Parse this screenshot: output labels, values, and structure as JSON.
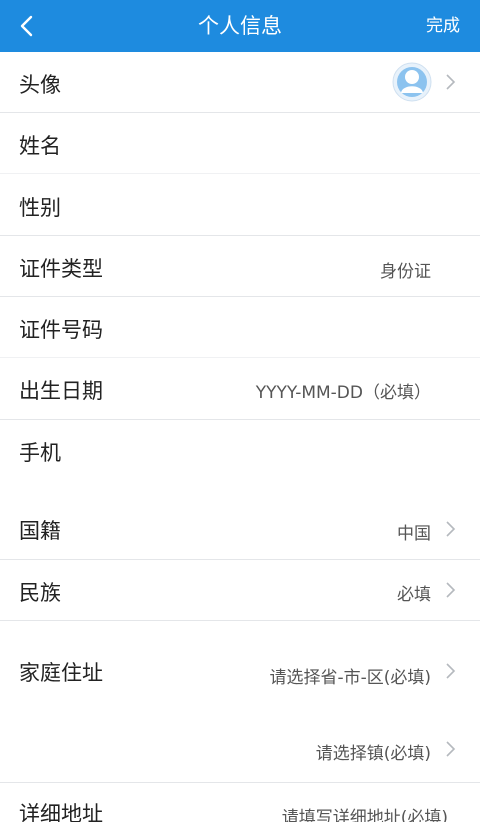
{
  "header": {
    "title": "个人信息",
    "done_label": "完成"
  },
  "rows": {
    "avatar": {
      "label": "头像"
    },
    "name": {
      "label": "姓名",
      "value": ""
    },
    "gender": {
      "label": "性别",
      "value": ""
    },
    "id_type": {
      "label": "证件类型",
      "value": "身份证"
    },
    "id_number": {
      "label": "证件号码",
      "value": ""
    },
    "birth_date": {
      "label": "出生日期",
      "value": "YYYY-MM-DD（必填）"
    },
    "phone": {
      "label": "手机",
      "value": ""
    },
    "nationality": {
      "label": "国籍",
      "value": "中国"
    },
    "ethnicity": {
      "label": "民族",
      "value": "必填"
    },
    "home_address": {
      "label": "家庭住址",
      "value": "请选择省-市-区(必填)"
    },
    "town": {
      "value": "请选择镇(必填)"
    },
    "detail_address": {
      "label": "详细地址",
      "value": "请填写详细地址(必填)"
    }
  },
  "colors": {
    "header_bg": "#1e8bdf",
    "page_bg": "#f5f6f8"
  }
}
